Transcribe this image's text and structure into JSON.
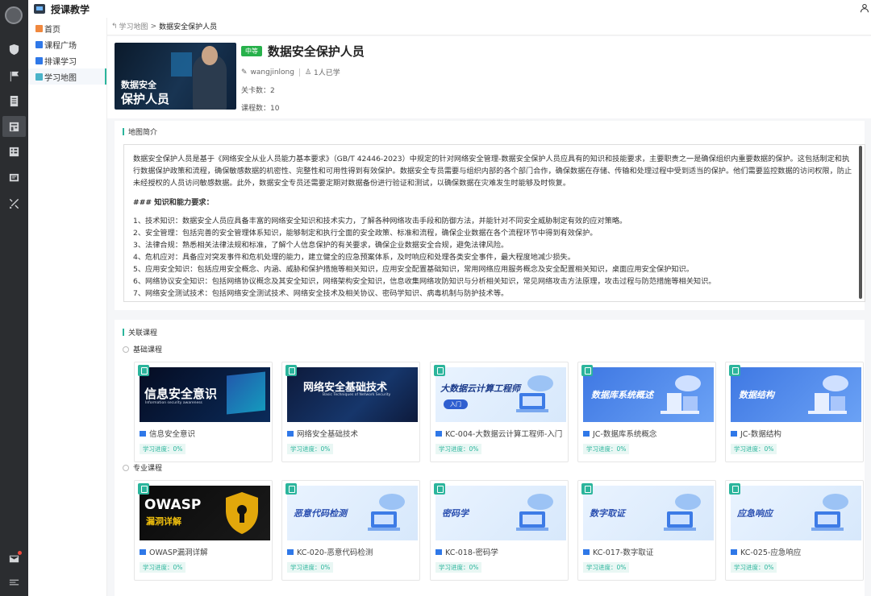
{
  "app": {
    "title": "授课教学"
  },
  "sidebar": {
    "items": [
      {
        "label": "首页",
        "color": "#f0883e"
      },
      {
        "label": "课程广场",
        "color": "#2f78e8"
      },
      {
        "label": "排课学习",
        "color": "#2f78e8"
      },
      {
        "label": "学习地图",
        "color": "#4ab3c9"
      }
    ],
    "active_index": 3
  },
  "breadcrumb": {
    "parent": "学习地图",
    "separator": ">",
    "current": "数据安全保护人员"
  },
  "map": {
    "hero_line1": "数据安全",
    "hero_line2": "保护人员",
    "level_tag": "中等",
    "title": "数据安全保护人员",
    "author": "wangjinlong",
    "learners": "1人已学",
    "level_count_label": "关卡数：",
    "level_count": "2",
    "course_count_label": "课程数：",
    "course_count": "10"
  },
  "intro": {
    "section_title": "地图简介",
    "paragraph": "数据安全保护人员是基于《网络安全从业人员能力基本要求》（GB/T 42446-2023）中规定的针对网络安全管理-数据安全保护人员应具有的知识和技能要求，主要职责之一是确保组织内重要数据的保护。这包括制定和执行数据保护政策和流程，确保敏感数据的机密性、完整性和可用性得到有效保护。数据安全专员需要与组织内部的各个部门合作，确保数据在存储、传输和处理过程中受到适当的保护。他们需要监控数据的访问权限，防止未经授权的人员访问敏感数据。此外，数据安全专员还需要定期对数据备份进行验证和测试，以确保数据在灾难发生时能够及时恢复。",
    "heading": "### 知识和能力要求：",
    "items": [
      "1、技术知识：数据安全人员应具备丰富的网络安全知识和技术实力，了解各种网络攻击手段和防御方法，并能针对不同安全威胁制定有效的应对策略。",
      "2、安全管理：包括完善的安全管理体系知识，能够制定和执行全面的安全政策、标准和流程，确保企业数据在各个流程环节中得到有效保护。",
      "3、法律合规：熟悉相关法律法规和标准，了解个人信息保护的有关要求，确保企业数据安全合规，避免法律风险。",
      "4、危机应对：具备应对突发事件和危机处理的能力，建立健全的应急预案体系，及时响应和处理各类安全事件，最大程度地减少损失。",
      "5、应用安全知识：包括应用安全概念、内涵、威胁和保护措施等相关知识，应用安全配置基础知识，常用网络应用服务概念及安全配置相关知识，桌面应用安全保护知识。",
      "6、网络协议安全知识：包括网络协议概念及其安全知识，网络架构安全知识，信息收集网络攻防知识与分析相关知识，常见网络攻击方法原理，攻击过程与防范措施等相关知识。",
      "7、网络安全测试技术：包括网络安全测试技术、网络安全技术及相关协议、密码学知识、病毒机制与防护技术等。"
    ]
  },
  "related": {
    "section_title": "关联课程",
    "groups": [
      {
        "label": "基础课程",
        "courses": [
          {
            "thumb_text": "信息安全意识",
            "thumb_sub": "Information security awareness",
            "name": "信息安全意识",
            "progress": "学习进度：0%"
          },
          {
            "thumb_text": "网络安全基础技术",
            "thumb_sub": "Basic Techniques of Network Security",
            "name": "网络安全基础技术",
            "progress": "学习进度：0%"
          },
          {
            "thumb_text": "大数据云计算工程师",
            "thumb_sub": "入门",
            "name": "KC-004-大数据云计算工程师-入门",
            "progress": "学习进度：0%"
          },
          {
            "thumb_text": "数据库系统概述",
            "thumb_sub": "",
            "name": "JC-数据库系统概念",
            "progress": "学习进度：0%"
          },
          {
            "thumb_text": "数据结构",
            "thumb_sub": "",
            "name": "JC-数据结构",
            "progress": "学习进度：0%"
          }
        ]
      },
      {
        "label": "专业课程",
        "courses": [
          {
            "thumb_text": "OWASP",
            "thumb_sub": "漏洞详解",
            "name": "OWASP漏洞详解",
            "progress": "学习进度：0%"
          },
          {
            "thumb_text": "恶意代码检测",
            "thumb_sub": "",
            "name": "KC-020-恶意代码检测",
            "progress": "学习进度：0%"
          },
          {
            "thumb_text": "密码学",
            "thumb_sub": "",
            "name": "KC-018-密码学",
            "progress": "学习进度：0%"
          },
          {
            "thumb_text": "数字取证",
            "thumb_sub": "",
            "name": "KC-017-数字取证",
            "progress": "学习进度：0%"
          },
          {
            "thumb_text": "应急响应",
            "thumb_sub": "",
            "name": "KC-025-应急响应",
            "progress": "学习进度：0%"
          }
        ]
      }
    ]
  },
  "colors": {
    "accent": "#2bb59c",
    "tag_green": "#27b14b",
    "rail": "#2b2d30",
    "course_icon": "#2f78e8"
  }
}
